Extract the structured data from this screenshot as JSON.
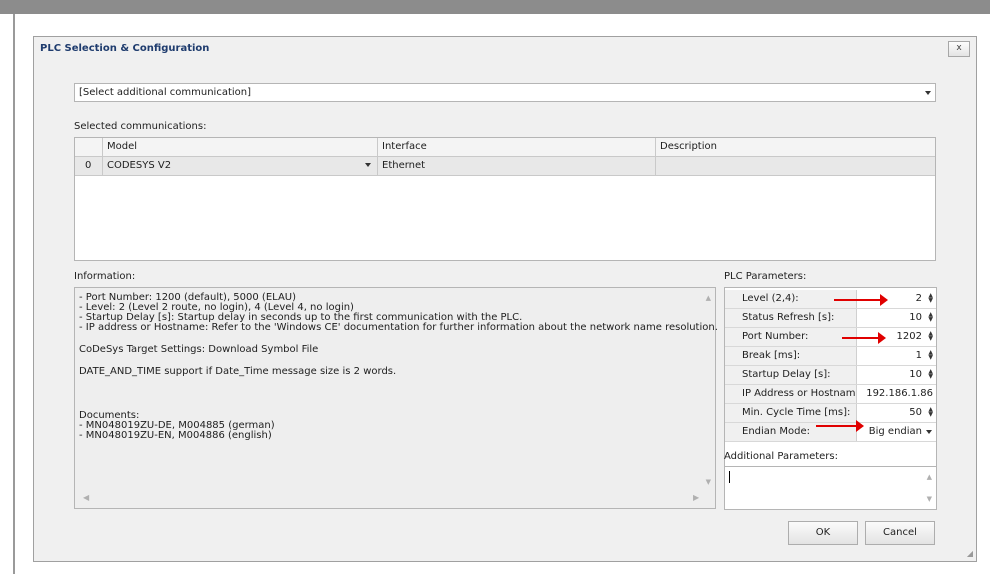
{
  "dialog": {
    "title": "PLC Selection & Configuration",
    "close_label": "x"
  },
  "communication_combo": {
    "value": "[Select additional communication]"
  },
  "selected_communications": {
    "label": "Selected communications:",
    "columns": [
      "Model",
      "Interface",
      "Description"
    ],
    "rows": [
      {
        "index": "0",
        "model": "CODESYS V2",
        "interface": "Ethernet",
        "description": ""
      }
    ]
  },
  "information": {
    "label": "Information:",
    "lines": [
      "- Port Number: 1200 (default), 5000 (ELAU)",
      "- Level: 2 (Level 2 route,  no login), 4 (Level 4, no login)",
      "- Startup Delay [s]: Startup delay in seconds up to the first communication with the PLC.",
      "- IP address or Hostname: Refer to the 'Windows CE' documentation for further information about the network name resolution.",
      "CoDeSys Target Settings: Download Symbol File",
      "DATE_AND_TIME support if Date_Time message size is 2 words.",
      "Documents:",
      "- MN048019ZU-DE, M004885 (german)",
      "- MN048019ZU-EN, M004886 (english)"
    ]
  },
  "plc_parameters": {
    "label": "PLC Parameters:",
    "rows": [
      {
        "name": "Level (2,4):",
        "value": "2",
        "control": "spin"
      },
      {
        "name": "Status Refresh [s]:",
        "value": "10",
        "control": "spin"
      },
      {
        "name": "Port Number:",
        "value": "1202",
        "control": "spin"
      },
      {
        "name": "Break [ms]:",
        "value": "1",
        "control": "spin"
      },
      {
        "name": "Startup Delay [s]:",
        "value": "10",
        "control": "spin"
      },
      {
        "name": "IP Address or Hostname",
        "value": "192.186.1.86",
        "control": "text"
      },
      {
        "name": "Min. Cycle Time [ms]:",
        "value": "50",
        "control": "spin"
      },
      {
        "name": "Endian Mode:",
        "value": "Big endian",
        "control": "dropdown"
      }
    ]
  },
  "additional_parameters": {
    "label": "Additional Parameters:",
    "value": ""
  },
  "buttons": {
    "ok": "OK",
    "cancel": "Cancel"
  },
  "colors": {
    "annotation_arrow": "#e00000",
    "title_text": "#1f3c6e"
  }
}
